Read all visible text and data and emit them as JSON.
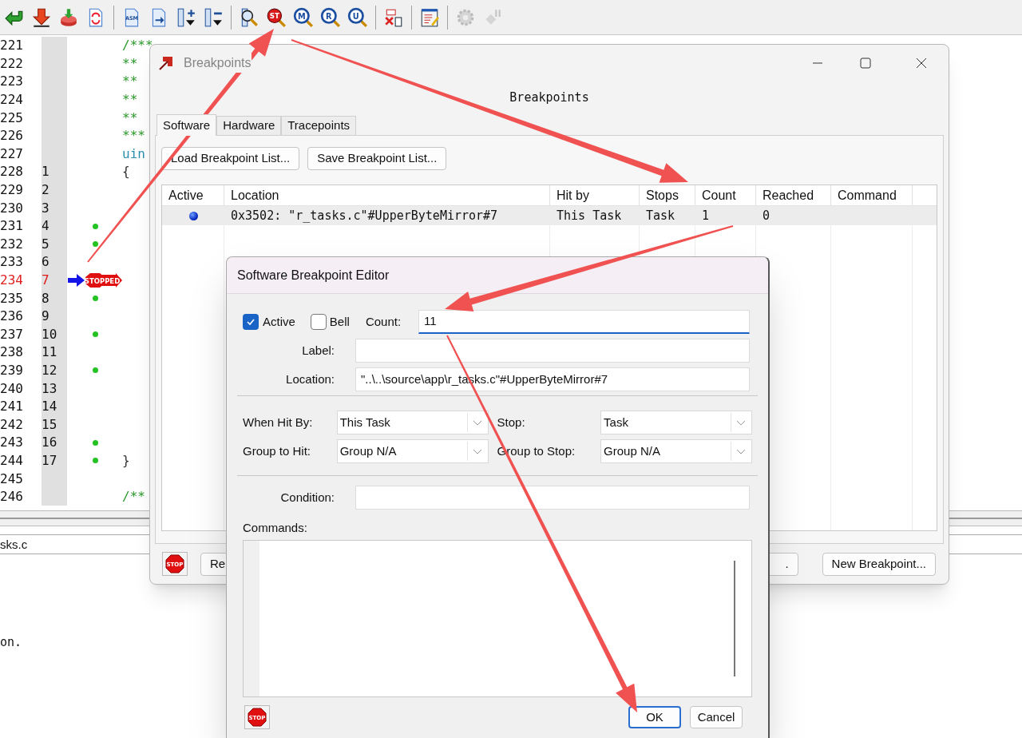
{
  "toolbar": [
    {
      "kind": "button",
      "disabled": false
    },
    {
      "kind": "button",
      "disabled": false
    },
    {
      "kind": "button",
      "disabled": false
    },
    {
      "kind": "button",
      "disabled": false
    },
    {
      "kind": "separator"
    },
    {
      "kind": "button",
      "disabled": false,
      "glyph": "ASM"
    },
    {
      "kind": "button",
      "disabled": false
    },
    {
      "kind": "button",
      "disabled": false
    },
    {
      "kind": "button",
      "disabled": false
    },
    {
      "kind": "separator"
    },
    {
      "kind": "button",
      "disabled": false
    },
    {
      "kind": "button",
      "disabled": false,
      "glyph": "ST"
    },
    {
      "kind": "button",
      "disabled": false,
      "glyph": "M"
    },
    {
      "kind": "button",
      "disabled": false,
      "glyph": "R"
    },
    {
      "kind": "button",
      "disabled": false,
      "glyph": "U"
    },
    {
      "kind": "separator"
    },
    {
      "kind": "button",
      "disabled": false
    },
    {
      "kind": "separator"
    },
    {
      "kind": "button",
      "disabled": false
    },
    {
      "kind": "separator"
    },
    {
      "kind": "button",
      "disabled": true
    },
    {
      "kind": "button",
      "disabled": true
    }
  ],
  "code_lines": [
    {
      "number": "221",
      "breakpoint": false,
      "current": false,
      "code": {
        "kind": "comment",
        "text": "/***"
      }
    },
    {
      "number": "222",
      "breakpoint": false,
      "current": false,
      "code": {
        "kind": "comment",
        "text": "**"
      }
    },
    {
      "number": "223",
      "breakpoint": false,
      "current": false,
      "code": {
        "kind": "comment",
        "text": "**"
      }
    },
    {
      "number": "224",
      "breakpoint": false,
      "current": false,
      "code": {
        "kind": "comment",
        "text": "**"
      }
    },
    {
      "number": "225",
      "breakpoint": false,
      "current": false,
      "code": {
        "kind": "comment",
        "text": "**"
      }
    },
    {
      "number": "226",
      "breakpoint": false,
      "current": false,
      "code": {
        "kind": "comment",
        "text": "***"
      }
    },
    {
      "number": "227",
      "breakpoint": false,
      "current": false,
      "code": {
        "kind": "keyword",
        "text": "uin"
      }
    },
    {
      "number": "228",
      "index": "1",
      "breakpoint": false,
      "current": false,
      "code": {
        "kind": "plain",
        "text": "{"
      }
    },
    {
      "number": "229",
      "index": "2",
      "breakpoint": false,
      "current": false
    },
    {
      "number": "230",
      "index": "3",
      "breakpoint": false,
      "current": false
    },
    {
      "number": "231",
      "index": "4",
      "breakpoint": true,
      "current": false
    },
    {
      "number": "232",
      "index": "5",
      "breakpoint": true,
      "current": false
    },
    {
      "number": "233",
      "index": "6",
      "breakpoint": false,
      "current": false
    },
    {
      "number": "234",
      "index": "7",
      "breakpoint": true,
      "current": true,
      "stop_glyph": "STOPPED"
    },
    {
      "number": "235",
      "index": "8",
      "breakpoint": true,
      "current": false
    },
    {
      "number": "236",
      "index": "9",
      "breakpoint": false,
      "current": false
    },
    {
      "number": "237",
      "index": "10",
      "breakpoint": true,
      "current": false
    },
    {
      "number": "238",
      "index": "11",
      "breakpoint": false,
      "current": false
    },
    {
      "number": "239",
      "index": "12",
      "breakpoint": true,
      "current": false
    },
    {
      "number": "240",
      "index": "13",
      "breakpoint": false,
      "current": false
    },
    {
      "number": "241",
      "index": "14",
      "breakpoint": false,
      "current": false
    },
    {
      "number": "242",
      "index": "15",
      "breakpoint": false,
      "current": false
    },
    {
      "number": "243",
      "index": "16",
      "breakpoint": true,
      "current": false
    },
    {
      "number": "244",
      "index": "17",
      "breakpoint": true,
      "current": false,
      "code": {
        "kind": "plain",
        "text": "}"
      }
    },
    {
      "number": "245",
      "breakpoint": false,
      "current": false
    },
    {
      "number": "246",
      "breakpoint": false,
      "current": false,
      "code": {
        "kind": "comment",
        "text": "/**"
      }
    }
  ],
  "file_bar": {
    "text": "sks.c"
  },
  "console": {
    "lines": [
      "on."
    ]
  },
  "breakpoints_window": {
    "title": "Breakpoints",
    "heading": "Breakpoints",
    "tabs": [
      {
        "label": "Software",
        "selected": true
      },
      {
        "label": "Hardware",
        "selected": false
      },
      {
        "label": "Tracepoints",
        "selected": false
      }
    ],
    "buttons": [
      "Load Breakpoint List...",
      "Save Breakpoint List..."
    ],
    "table": {
      "columns": [
        "Active",
        "Location",
        "Hit by",
        "Stops",
        "Count",
        "Reached",
        "Command"
      ],
      "rows": [
        {
          "active": true,
          "cells": [
            "",
            "0x3502: \"r_tasks.c\"#UpperByteMirror#7",
            "This Task",
            "Task",
            "1",
            "0"
          ]
        }
      ]
    },
    "footer": {
      "stop_glyph": "STOP",
      "left_button": "Re",
      "middle_button": ".",
      "right_button": "New Breakpoint..."
    }
  },
  "editor_window": {
    "title": "Software Breakpoint Editor",
    "active": {
      "label": "Active",
      "checked": true
    },
    "bell": {
      "label": "Bell",
      "checked": false
    },
    "count": {
      "label": "Count:",
      "value": "11"
    },
    "label_field": {
      "label": "Label:"
    },
    "location": {
      "label": "Location:",
      "value": "\"..\\..\\source\\app\\r_tasks.c\"#UpperByteMirror#7"
    },
    "when_hit_by": {
      "label": "When Hit By:",
      "value": "This Task"
    },
    "stop": {
      "label": "Stop:",
      "value": "Task"
    },
    "group_to_hit": {
      "label": "Group to Hit:",
      "value": "Group N/A"
    },
    "group_to_stop": {
      "label": "Group to Stop:",
      "value": "Group N/A"
    },
    "condition": {
      "label": "Condition:"
    },
    "commands": {
      "label": "Commands:"
    },
    "stop_glyph": "STOP",
    "buttons": [
      {
        "label": "OK",
        "default": true
      },
      {
        "label": "Cancel",
        "default": false
      }
    ]
  }
}
